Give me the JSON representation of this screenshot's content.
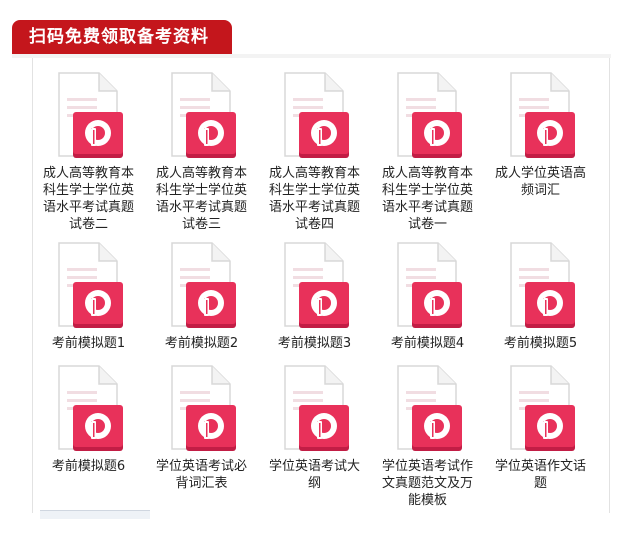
{
  "header": {
    "title": "扫码免费领取备考资料"
  },
  "files": [
    {
      "label": "成人高等教育本科生学士学位英语水平考试真题试卷二",
      "icon": "pdf-file-icon"
    },
    {
      "label": "成人高等教育本科生学士学位英语水平考试真题试卷三",
      "icon": "pdf-file-icon"
    },
    {
      "label": "成人高等教育本科生学士学位英语水平考试真题试卷四",
      "icon": "pdf-file-icon"
    },
    {
      "label": "成人高等教育本科生学士学位英语水平考试真题试卷一",
      "icon": "pdf-file-icon"
    },
    {
      "label": "成人学位英语高频词汇",
      "icon": "pdf-file-icon"
    },
    {
      "label": "考前模拟题1",
      "icon": "pdf-file-icon"
    },
    {
      "label": "考前模拟题2",
      "icon": "pdf-file-icon"
    },
    {
      "label": "考前模拟题3",
      "icon": "pdf-file-icon"
    },
    {
      "label": "考前模拟题4",
      "icon": "pdf-file-icon"
    },
    {
      "label": "考前模拟题5",
      "icon": "pdf-file-icon"
    },
    {
      "label": "考前模拟题6",
      "icon": "pdf-file-icon"
    },
    {
      "label": "学位英语考试必背词汇表",
      "icon": "pdf-file-icon"
    },
    {
      "label": "学位英语考试大纲",
      "icon": "pdf-file-icon"
    },
    {
      "label": "学位英语考试作文真题范文及万能模板",
      "icon": "pdf-file-icon"
    },
    {
      "label": "学位英语作文话题",
      "icon": "pdf-file-icon"
    }
  ],
  "colors": {
    "header": "#c4161c",
    "pdf_badge": "#e8315a",
    "pdf_badge_dark": "#c21d45"
  }
}
